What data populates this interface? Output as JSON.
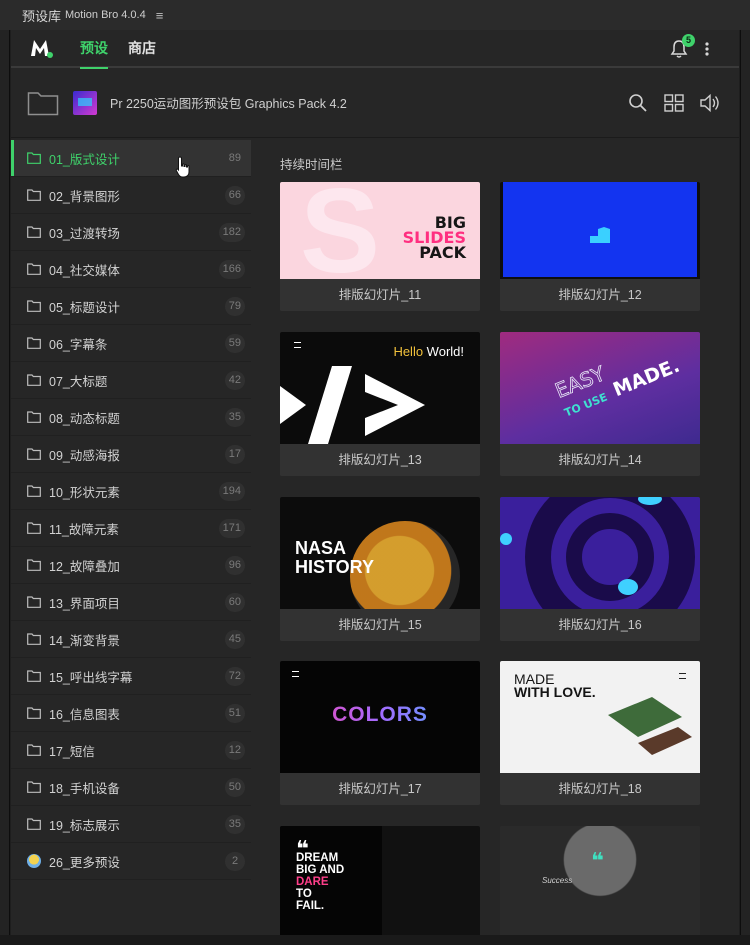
{
  "window": {
    "title": "预设库",
    "subtitle": "Motion Bro 4.0.4",
    "menu_icon": "hamburger-menu-icon"
  },
  "nav": {
    "tabs": [
      "预设",
      "商店"
    ],
    "active_tab": "预设",
    "notification_count": "5",
    "colors": {
      "accent": "#3fd26b",
      "background": "#262626"
    }
  },
  "pack": {
    "title": "Pr 2250运动图形预设包 Graphics Pack 4.2",
    "icons": [
      "search-icon",
      "grid-view-icon",
      "volume-icon"
    ]
  },
  "sidebar": {
    "items": [
      {
        "label": "01_版式设计",
        "count": "89",
        "active": true
      },
      {
        "label": "02_背景图形",
        "count": "66"
      },
      {
        "label": "03_过渡转场",
        "count": "182"
      },
      {
        "label": "04_社交媒体",
        "count": "166"
      },
      {
        "label": "05_标题设计",
        "count": "79"
      },
      {
        "label": "06_字幕条",
        "count": "59"
      },
      {
        "label": "07_大标题",
        "count": "42"
      },
      {
        "label": "08_动态标题",
        "count": "35"
      },
      {
        "label": "09_动感海报",
        "count": "17"
      },
      {
        "label": "10_形状元素",
        "count": "194"
      },
      {
        "label": "11_故障元素",
        "count": "171"
      },
      {
        "label": "12_故障叠加",
        "count": "96"
      },
      {
        "label": "13_界面项目",
        "count": "60"
      },
      {
        "label": "14_渐变背景",
        "count": "45"
      },
      {
        "label": "15_呼出线字幕",
        "count": "72"
      },
      {
        "label": "16_信息图表",
        "count": "51"
      },
      {
        "label": "17_短信",
        "count": "12"
      },
      {
        "label": "18_手机设备",
        "count": "50"
      },
      {
        "label": "19_标志展示",
        "count": "35"
      },
      {
        "label": "26_更多预设",
        "count": "2"
      }
    ]
  },
  "content": {
    "section_title": "持续时间栏",
    "presets": [
      {
        "label": "排版幻灯片_11"
      },
      {
        "label": "排版幻灯片_12"
      },
      {
        "label": "排版幻灯片_13"
      },
      {
        "label": "排版幻灯片_14"
      },
      {
        "label": "排版幻灯片_15"
      },
      {
        "label": "排版幻灯片_16"
      },
      {
        "label": "排版幻灯片_17"
      },
      {
        "label": "排版幻灯片_18"
      },
      {
        "label": ""
      },
      {
        "label": ""
      }
    ],
    "thumb_text": {
      "t11": [
        "BIG",
        "SLIDES",
        "PACK"
      ],
      "t13_hello": "Hello",
      "t13_world": " World!",
      "t14": [
        "EASY",
        "TO USE",
        "MADE."
      ],
      "t15": [
        "NASA",
        "HISTORY"
      ],
      "t17": "COLORS",
      "t18": [
        "MADE",
        "WITH LOVE."
      ],
      "t19": [
        "DREAM",
        "BIG AND",
        "DARE",
        "TO",
        "FAIL."
      ],
      "t20": "Success"
    }
  }
}
